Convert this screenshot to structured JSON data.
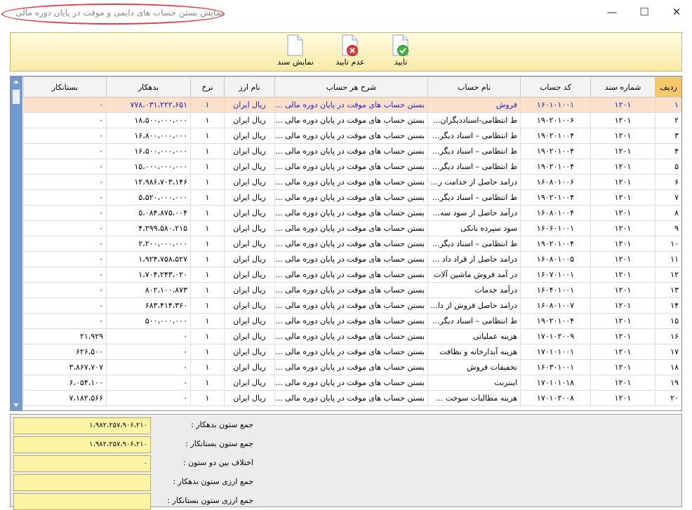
{
  "window": {
    "title": "نمایش بستن حساب های دایمی و موقت در پایان دوره مالی",
    "minimize": "—",
    "maximize": "☐",
    "close": "✕"
  },
  "toolbar": {
    "confirm_label": "تایید",
    "reject_label": "عدم تایید",
    "show_doc_label": "نمایش سند"
  },
  "grid": {
    "headers": {
      "row": "ردیف",
      "doc_no": "شماره سند",
      "account_code": "کد حساب",
      "account_name": "نام حساب",
      "description": "شرح هر حساب",
      "currency": "نام ارز",
      "rate": "نرخ",
      "debit": "بدهکار",
      "credit": "بستانکار"
    },
    "rows": [
      {
        "row": "۱",
        "doc": "۱۲۰۱",
        "code": "۱۶۰۱۰۱۰۰۱",
        "name": "فروش",
        "desc": "بستن حساب های موقت در پایان دوره مالی ...",
        "cur": "ریال ایران",
        "rate": "۱",
        "debit": "۷۷۸،۰۳۱،۲۲۲،۶۵۱",
        "credit": "۰"
      },
      {
        "row": "۲",
        "doc": "۱۲۰۱",
        "code": "۱۹۰۲۰۱۰۰۶",
        "name": "ط انتظامی-اسناددیگران...",
        "desc": "بستن حساب های موقت در پایان دوره مالی ...",
        "cur": "ریال ایران",
        "rate": "۱",
        "debit": "۱۸،۵۰۰،۰۰۰،۰۰۰",
        "credit": "۰"
      },
      {
        "row": "۳",
        "doc": "۱۲۰۱",
        "code": "۱۹۰۲۰۱۰۰۴",
        "name": "ط انتظامی – اسناد دیگر...",
        "desc": "بستن حساب های موقت در پایان دوره مالی ...",
        "cur": "ریال ایران",
        "rate": "۱",
        "debit": "۱۶،۸۰۰،۰۰۰،۰۰۰",
        "credit": "۰"
      },
      {
        "row": "۴",
        "doc": "۱۲۰۱",
        "code": "۱۹۰۲۰۱۰۰۴",
        "name": "ط انتظامی – اسناد دیگر...",
        "desc": "بستن حساب های موقت در پایان دوره مالی ...",
        "cur": "ریال ایران",
        "rate": "۱",
        "debit": "۱۶،۵۰۰،۰۰۰،۰۰۰",
        "credit": "۰"
      },
      {
        "row": "۵",
        "doc": "۱۲۰۱",
        "code": "۱۹۰۲۰۱۰۰۴",
        "name": "ط انتظامی – اسناد دیگر...",
        "desc": "بستن حساب های موقت در پایان دوره مالی ...",
        "cur": "ریال ایران",
        "rate": "۱",
        "debit": "۱۵،۰۰۰،۰۰۰،۰۰۰",
        "credit": "۰"
      },
      {
        "row": "۶",
        "doc": "۱۲۰۱",
        "code": "۱۶۰۸۰۱۰۰۶",
        "name": "درامد حاصل از خدامت ر...",
        "desc": "بستن حساب های موقت در پایان دوره مالی ...",
        "cur": "ریال ایران",
        "rate": "۱",
        "debit": "۱۲،۹۸۶،۷۰۳،۱۴۶",
        "credit": "۰"
      },
      {
        "row": "۷",
        "doc": "۱۲۰۱",
        "code": "۱۹۰۲۰۱۰۰۴",
        "name": "ط انتظامی – اسناد دیگر...",
        "desc": "بستن حساب های موقت در پایان دوره مالی ...",
        "cur": "ریال ایران",
        "rate": "۱",
        "debit": "۵،۵۲۰،۰۰۰،۰۰۰",
        "credit": "۰"
      },
      {
        "row": "۸",
        "doc": "۱۲۰۱",
        "code": "۱۶۰۸۰۱۰۰۴",
        "name": "درآمد حاصل از سود سه...",
        "desc": "بستن حساب های موقت در پایان دوره مالی ...",
        "cur": "ریال ایران",
        "rate": "۱",
        "debit": "۵،۰۸۴،۸۷۵،۰۰۴",
        "credit": "۰"
      },
      {
        "row": "۹",
        "doc": "۱۲۰۱",
        "code": "۱۶۰۶۰۱۰۰۱",
        "name": "سود سپرده بانکی",
        "desc": "بستن حساب های موقت در پایان دوره مالی ...",
        "cur": "ریال ایران",
        "rate": "۱",
        "debit": "۴،۲۹۹،۵۸۰،۲۱۵",
        "credit": "۰"
      },
      {
        "row": "۱۰",
        "doc": "۱۲۰۱",
        "code": "۱۹۰۲۰۱۰۰۴",
        "name": "ط انتظامی – اسناد دیگر...",
        "desc": "بستن حساب های موقت در پایان دوره مالی ...",
        "cur": "ریال ایران",
        "rate": "۱",
        "debit": "۲،۲۰۰،۰۰۰،۰۰۰",
        "credit": "۰"
      },
      {
        "row": "۱۱",
        "doc": "۱۲۰۱",
        "code": "۱۶۰۸۰۱۰۰۵",
        "name": "درامد حاصل از قراد داد ...",
        "desc": "بستن حساب های موقت در پایان دوره مالی ...",
        "cur": "ریال ایران",
        "rate": "۱",
        "debit": "۱،۹۲۴،۷۵۸،۵۲۷",
        "credit": "۰"
      },
      {
        "row": "۱۲",
        "doc": "۱۲۰۱",
        "code": "۱۶۰۷۰۱۰۰۱",
        "name": "در آمد فروش ماشین آلات",
        "desc": "بستن حساب های موقت در پایان دوره مالی ...",
        "cur": "ریال ایران",
        "rate": "۱",
        "debit": "۱،۷۰۴،۲۴۳،۰۲۰",
        "credit": "۰"
      },
      {
        "row": "۱۳",
        "doc": "۱۲۰۱",
        "code": "۱۶۰۴۰۱۰۰۱",
        "name": "درآمد خدمات",
        "desc": "بستن حساب های موقت در پایان دوره مالی ...",
        "cur": "ریال ایران",
        "rate": "۱",
        "debit": "۸۰۲،۱۰۰،۸۷۳",
        "credit": "۰"
      },
      {
        "row": "۱۴",
        "doc": "۱۲۰۱",
        "code": "۱۶۰۸۰۱۰۰۷",
        "name": "درامد حاصل فروش از دا...",
        "desc": "بستن حساب های موقت در پایان دوره مالی ...",
        "cur": "ریال ایران",
        "rate": "۱",
        "debit": "۶۸۳،۴۱۴،۳۶۰",
        "credit": "۰"
      },
      {
        "row": "۱۵",
        "doc": "۱۲۰۱",
        "code": "۱۹۰۲۰۱۰۰۴",
        "name": "ط انتظامی – اسناد دیگر...",
        "desc": "بستن حساب های موقت در پایان دوره مالی ...",
        "cur": "ریال ایران",
        "rate": "۱",
        "debit": "۵۰۰،۰۰۰،۰۰۰",
        "credit": "۰"
      },
      {
        "row": "۱۶",
        "doc": "۱۲۰۱",
        "code": "۱۷۰۱۰۲۰۰۹",
        "name": "هزینه عملیاتی",
        "desc": "بستن حساب های موقت در پایان دوره مالی ...",
        "cur": "ریال ایران",
        "rate": "۱",
        "debit": "۰",
        "credit": "۲۱،۹۲۹"
      },
      {
        "row": "۱۷",
        "doc": "۱۲۰۱",
        "code": "۱۷۰۱۰۱۰۰۱",
        "name": "هزینه آبدارخانه و نظافت",
        "desc": "بستن حساب های موقت در پایان دوره مالی ...",
        "cur": "ریال ایران",
        "rate": "۱",
        "debit": "۰",
        "credit": "۶۲۶،۵۰۰"
      },
      {
        "row": "۱۸",
        "doc": "۱۲۰۱",
        "code": "۱۶۰۳۰۱۰۰۱",
        "name": "تخفیفات فروش",
        "desc": "بستن حساب های موقت در پایان دوره مالی ...",
        "cur": "ریال ایران",
        "rate": "۱",
        "debit": "۰",
        "credit": "۳،۸۶۷،۷۰۷"
      },
      {
        "row": "۱۹",
        "doc": "۱۲۰۱",
        "code": "۱۷۰۱۰۱۰۱۸",
        "name": "اینترنت",
        "desc": "بستن حساب های موقت در پایان دوره مالی ...",
        "cur": "ریال ایران",
        "rate": "۱",
        "debit": "۰",
        "credit": "۶،۰۵۴،۱۰۰"
      },
      {
        "row": "۲۰",
        "doc": "۱۲۰۱",
        "code": "۱۷۰۱۰۲۰۰۸",
        "name": "هزینه مطالبات سوخت ...",
        "desc": "بستن حساب های موقت در پایان دوره مالی ...",
        "cur": "ریال ایران",
        "rate": "۱",
        "debit": "۰",
        "credit": "۷،۱۸۲،۵۶۶"
      }
    ]
  },
  "summary": {
    "debit_total_label": "جمع ستون بدهکار :",
    "debit_total_value": "۱،۹۸۲،۲۵۷،۹۰۶،۲۱۰",
    "credit_total_label": "جمع ستون بستانکار :",
    "credit_total_value": "۱،۹۸۲،۲۵۷،۹۰۶،۲۱۰",
    "difference_label": "اختلاف بین دو ستون :",
    "difference_value": "۰",
    "currency_debit_label": "جمع ارزی ستون بدهکار :",
    "currency_debit_value": "",
    "currency_credit_label": "جمع ارزی ستون بستانکار :",
    "currency_credit_value": ""
  },
  "colors": {
    "toolbar_bg": "#f8eaa6",
    "selected_row_bg": "#fbe0cc",
    "selected_row_text": "#1f1fd0",
    "header_selected": "#f7c86a",
    "summary_box": "#fdf5a6",
    "title_highlight": "#e0404a"
  }
}
